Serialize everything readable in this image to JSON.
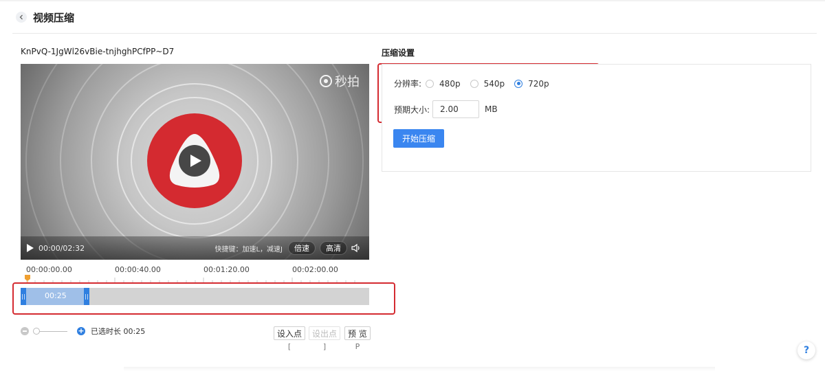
{
  "header": {
    "title": "视频压缩",
    "back_icon": "chevron-left-icon"
  },
  "video": {
    "file_name": "KnPvQ-1JgWl26vBie-tnjhghPCfPP~D7",
    "watermark": "秒拍",
    "current_time": "00:00/02:32",
    "shortcut_hint": "快捷键：加速L，减速J",
    "speed_label": "倍速",
    "quality_label": "高清"
  },
  "timeline": {
    "ticks": [
      "00:00:00.00",
      "00:00:40.00",
      "00:01:20.00",
      "00:02:00.00"
    ],
    "selection_label": "00:25",
    "selected_duration_label": "已选时长 00:25",
    "zoom_level": 0
  },
  "marks": {
    "set_in": {
      "label": "设入点",
      "key": "["
    },
    "set_out": {
      "label": "设出点",
      "key": "]"
    },
    "preview": {
      "label": "预 览",
      "key": "P"
    }
  },
  "settings": {
    "title": "压缩设置",
    "resolution_label": "分辨率:",
    "resolution_options": [
      "480p",
      "540p",
      "720p"
    ],
    "resolution_selected": "720p",
    "size_label": "预期大小:",
    "size_value": "2.00",
    "size_unit": "MB",
    "start_button": "开始压缩"
  },
  "help": {
    "label": "?"
  },
  "colors": {
    "accent": "#3a86f0",
    "highlight": "#d42a30"
  }
}
